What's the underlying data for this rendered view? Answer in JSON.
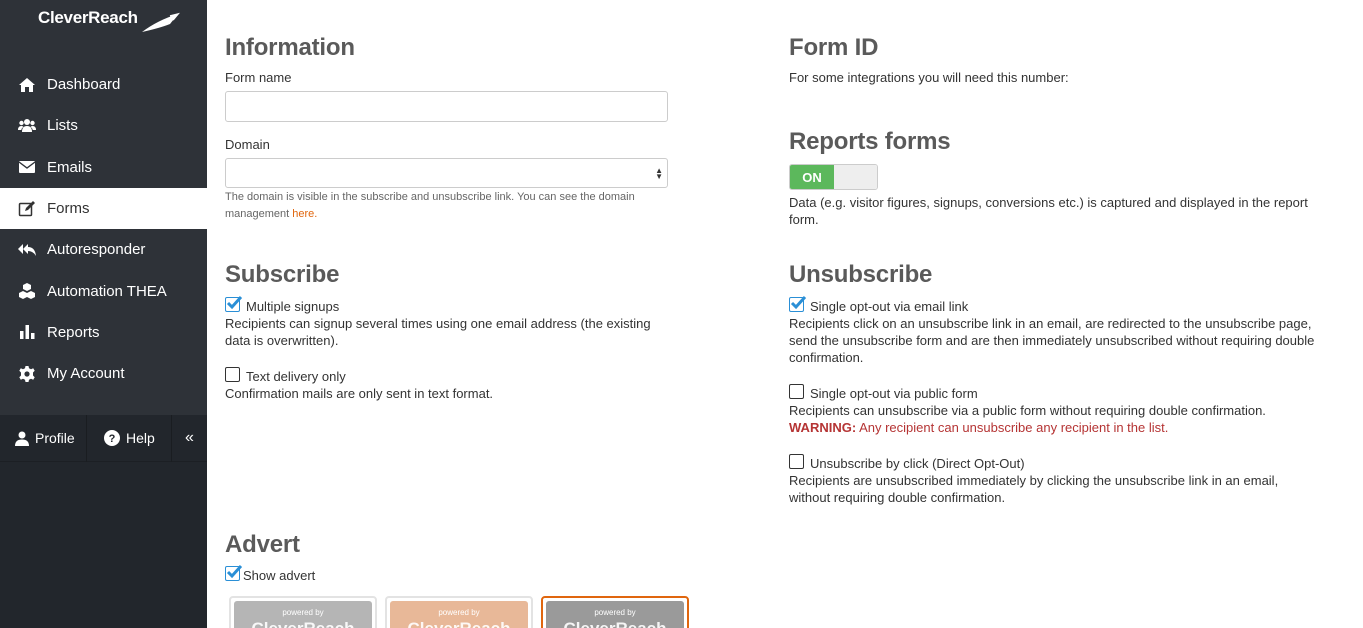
{
  "sidebar": {
    "logo": "CleverReach",
    "items": [
      {
        "label": "Dashboard",
        "icon": "home-icon"
      },
      {
        "label": "Lists",
        "icon": "users-icon"
      },
      {
        "label": "Emails",
        "icon": "envelope-icon"
      },
      {
        "label": "Forms",
        "icon": "edit-icon",
        "active": true
      },
      {
        "label": "Autoresponder",
        "icon": "reply-all-icon"
      },
      {
        "label": "Automation THEA",
        "icon": "cubes-icon"
      },
      {
        "label": "Reports",
        "icon": "bar-chart-icon"
      },
      {
        "label": "My Account",
        "icon": "gear-icon"
      }
    ],
    "bottom": {
      "profile": "Profile",
      "help": "Help",
      "collapse": "«"
    }
  },
  "information": {
    "title": "Information",
    "form_name_label": "Form name",
    "form_name_value": "",
    "domain_label": "Domain",
    "domain_hint": "The domain is visible in the subscribe and unsubscribe link. You can see the domain management",
    "domain_link": "here."
  },
  "form_id": {
    "title": "Form ID",
    "text": "For some integrations you will need this number:"
  },
  "reports_forms": {
    "title": "Reports forms",
    "toggle_label": "ON",
    "toggle_state": true,
    "text": "Data (e.g. visitor figures, signups, conversions etc.) is captured and displayed in the report form."
  },
  "subscribe": {
    "title": "Subscribe",
    "options": [
      {
        "label": "Multiple signups",
        "checked": true,
        "desc": "Recipients can signup several times using one email address (the existing data is overwritten)."
      },
      {
        "label": "Text delivery only",
        "checked": false,
        "desc": "Confirmation mails are only sent in text format."
      }
    ]
  },
  "unsubscribe": {
    "title": "Unsubscribe",
    "options": [
      {
        "label": "Single opt-out via email link",
        "checked": true,
        "desc": "Recipients click on an unsubscribe link in an email, are redirected to the unsubscribe page, send the unsubscribe form and are then immediately unsubscribed without requiring double confirmation."
      },
      {
        "label": "Single opt-out via public form",
        "checked": false,
        "desc": "Recipients can unsubscribe via a public form without requiring double confirmation.",
        "warning_label": "WARNING:",
        "warning_text": "Any recipient can unsubscribe any recipient in the list."
      },
      {
        "label": "Unsubscribe by click (Direct Opt-Out)",
        "checked": false,
        "desc": "Recipients are unsubscribed immediately by clicking the unsubscribe link in an email, without requiring double confirmation."
      }
    ]
  },
  "advert": {
    "title": "Advert",
    "show_label": "Show advert",
    "show_checked": true,
    "thumbs": [
      {
        "caption": "powered by",
        "brand": "CleverReach",
        "color": "#b5b5b5"
      },
      {
        "caption": "powered by",
        "brand": "CleverReach",
        "color": "#e8b898"
      },
      {
        "caption": "powered by",
        "brand": "CleverReach",
        "color": "#9a9a9a",
        "selected": true
      }
    ]
  }
}
